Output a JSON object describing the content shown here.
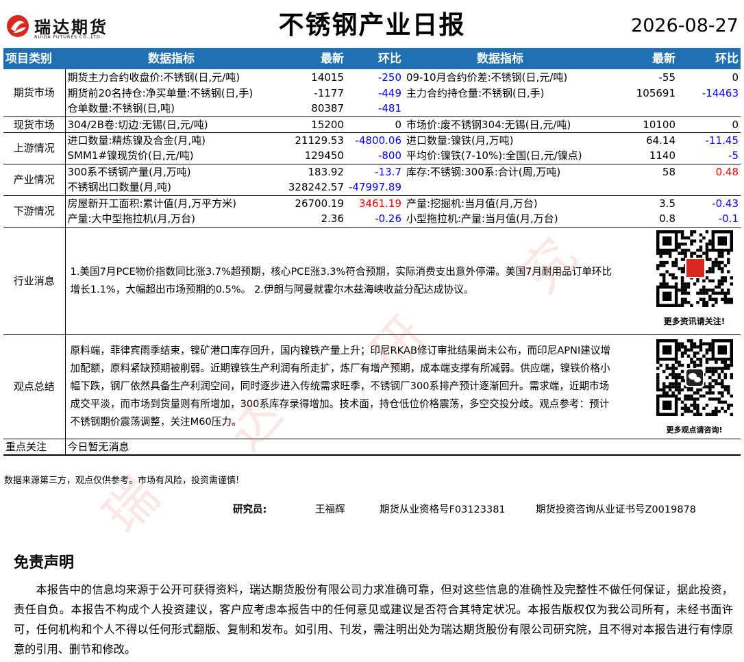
{
  "header": {
    "company_cn": "瑞达期货",
    "company_en": "RUIDA FUTURES CO.,LTD.",
    "title": "不锈钢产业日报",
    "date": "2026-08-27",
    "brand_color": "#d9281f"
  },
  "table": {
    "headers": [
      "项目类别",
      "数据指标",
      "最新",
      "环比",
      "数据指标",
      "最新",
      "环比"
    ],
    "header_color": "#1f6fb5",
    "sections": [
      {
        "category": "期货市场",
        "rows": [
          [
            "期货主力合约收盘价:不锈钢(日,元/吨)",
            "14015",
            "-250",
            "09-10月合约价差:不锈钢(日,元/吨)",
            "-55",
            "0"
          ],
          [
            "期货前20名持仓:净买单量:不锈钢(日,手)",
            "-1177",
            "-449",
            "主力合约持仓量:不锈钢(日,手)",
            "105691",
            "-14463"
          ],
          [
            "仓单数量:不锈钢(日,吨)",
            "80387",
            "-481",
            "",
            "",
            ""
          ]
        ]
      },
      {
        "category": "现货市场",
        "rows": [
          [
            "304/2B卷:切边:无锡(日,元/吨)",
            "15200",
            "0",
            "市场价:废不锈钢304:无锡(日,元/吨)",
            "10100",
            "0"
          ]
        ]
      },
      {
        "category": "上游情况",
        "rows": [
          [
            "进口数量:精炼镍及合金(月,吨)",
            "21129.53",
            "-4800.06",
            "进口数量:镍铁(月,万吨)",
            "64.14",
            "-11.45"
          ],
          [
            "SMM1#镍现货价(日,元/吨)",
            "129450",
            "-800",
            "平均价:镍铁(7-10%):全国(日,元/镍点)",
            "1140",
            "-5"
          ]
        ]
      },
      {
        "category": "产业情况",
        "rows": [
          [
            "300系不锈钢产量(月,万吨)",
            "183.92",
            "-13.7",
            "库存:不锈钢:300系:合计(周,万吨)",
            "58",
            "0.48"
          ],
          [
            "不锈钢出口数量(月,吨)",
            "328242.57",
            "-47997.89",
            "",
            "",
            ""
          ]
        ]
      },
      {
        "category": "下游情况",
        "rows": [
          [
            "房屋新开工面积:累计值(月,万平方米)",
            "26700.19",
            "3461.19",
            "产量:挖掘机:当月值(月,万台)",
            "3.5",
            "-0.43"
          ],
          [
            "产量:大中型拖拉机(月,万台)",
            "2.36",
            "-0.26",
            "小型拖拉机:产量:当月值(月,万台)",
            "0.8",
            "-0.1"
          ]
        ]
      }
    ],
    "news": {
      "category": "行业消息",
      "text": "1.美国7月PCE物价指数同比涨3.7%超预期，核心PCE涨3.3%符合预期，实际消费支出意外停滞。美国7月耐用品订单环比增长1.1%，大幅超出市场预期的0.5%。 2.伊朗与阿曼就霍尔木兹海峡收益分配达成协议。",
      "qr_caption": "更多资讯请关注!"
    },
    "view": {
      "category": "观点总结",
      "text": "原料端，菲律宾雨季结束，镍矿港口库存回升，国内镍铁产量上升；印尼RKAB修订审批结果尚未公布，而印尼APNI建议增加配额，原料紧缺预期被削弱。近期镍铁生产利润有所走扩，炼厂有增产预期，成本端支撑有所减弱。供应端，镍铁价格小幅下跌，钢厂依然具备生产利润空间，同时逐步进入传统需求旺季，不锈钢厂300系排产预计逐渐回升。需求端，近期市场成交平淡，而市场到货量则有所增加，300系库存录得增加。技术面，持仓低位价格震荡，多空交投分歧。观点参考：预计不锈钢期价震荡调整，关注M60压力。",
      "qr_caption": "更多观点请咨询!"
    },
    "focus": {
      "category": "重点关注",
      "text": "今日暂无消息"
    },
    "negative_color": "#0000ff",
    "positive_color": "#ff0000"
  },
  "footer": {
    "source": "数据来源第三方，观点仅供参考。市场有风险，投资需谨慎!",
    "researcher_label": "研究员:",
    "researcher_name": "王福辉",
    "qualification": "期货从业资格号F03123381",
    "consult_cert": "期货投资咨询从业证书号Z0019878"
  },
  "disclaimer": {
    "title": "免责声明",
    "body": "本报告中的信息均来源于公开可获得资料，瑞达期货股份有限公司力求准确可靠，但对这些信息的准确性及完整性不做任何保证，据此投资，责任自负。本报告不构成个人投资建议，客户应考虑本报告中的任何意见或建议是否符合其特定状况。本报告版权仅为我公司所有，未经书面许可，任何机构和个人不得以任何形式翻版、复制和发布。如引用、刊发，需注明出处为瑞达期货股份有限公司研究院，且不得对本报告进行有悖原意的引用、删节和修改。"
  },
  "watermark": [
    "瑞",
    "达",
    "研",
    "究"
  ],
  "icons": [
    "ruida-logo-icon",
    "qr-code-icon",
    "wechat-icon"
  ]
}
